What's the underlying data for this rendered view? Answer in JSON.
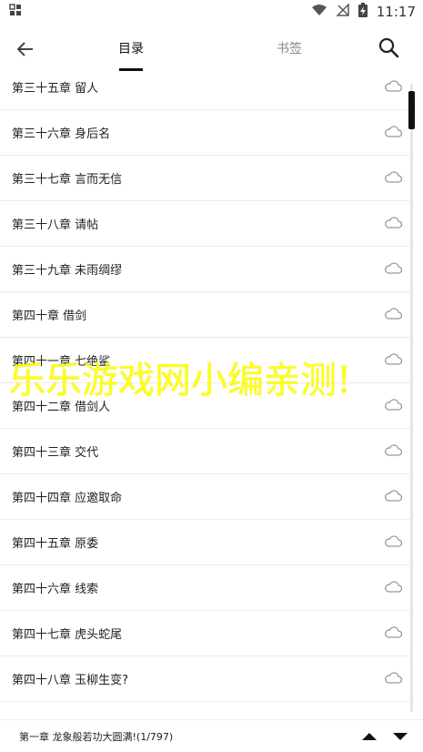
{
  "status": {
    "time": "11:17"
  },
  "appbar": {
    "tab_toc": "目录",
    "tab_bookmark": "书签"
  },
  "chapters": [
    "第三十五章 留人",
    "第三十六章 身后名",
    "第三十七章 言而无信",
    "第三十八章 请帖",
    "第三十九章 未雨绸缪",
    "第四十章 借剑",
    "第四十一章 七绝鲨",
    "第四十二章 借剑人",
    "第四十三章 交代",
    "第四十四章 应邀取命",
    "第四十五章 原委",
    "第四十六章 线索",
    "第四十七章 虎头蛇尾",
    "第四十八章 玉柳生变?"
  ],
  "watermark": "乐乐游戏网小编亲测!",
  "bottom": {
    "current": "第一章 龙象般若功大圆满!(1/797)"
  },
  "icons": {
    "back": "arrow-left-icon",
    "search": "search-icon",
    "cloud": "cloud-icon",
    "up": "triangle-up-icon",
    "down": "triangle-down-icon"
  }
}
